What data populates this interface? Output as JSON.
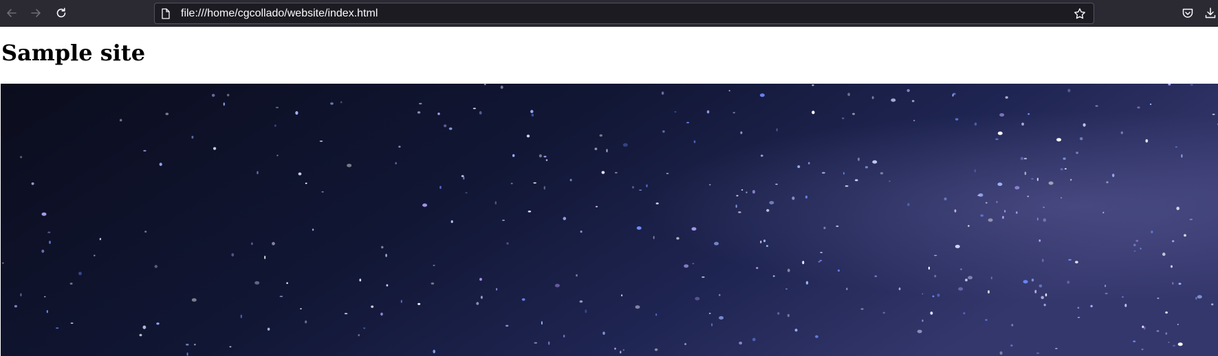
{
  "browser": {
    "url": "file:///home/cgcollado/website/index.html",
    "icons": {
      "back": "arrow-left-icon",
      "forward": "arrow-right-icon",
      "reload": "reload-icon",
      "page": "page-icon",
      "bookmark": "star-icon",
      "pocket": "pocket-icon",
      "download": "download-icon"
    }
  },
  "page": {
    "title": "Sample site",
    "image": {
      "subject": "starry-night-sky",
      "colors": {
        "sky_dark": "#0a0c1c",
        "sky_mid": "#1a1f46",
        "sky_light": "#3c3f78"
      }
    }
  }
}
